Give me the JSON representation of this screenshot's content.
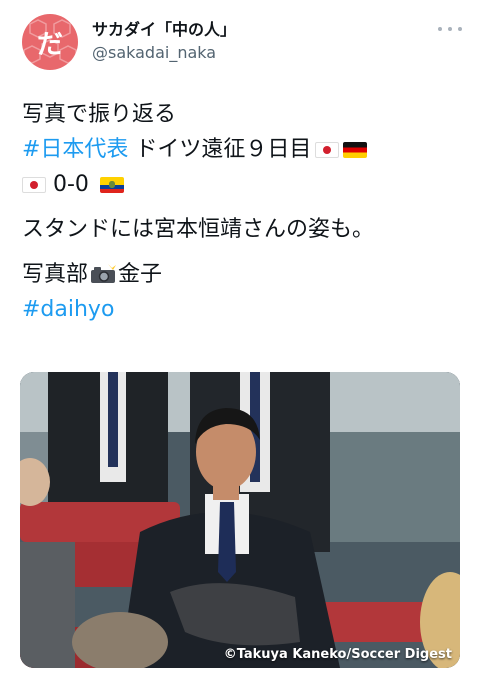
{
  "user": {
    "display_name": "サカダイ「中の人」",
    "handle": "@sakadai_naka",
    "avatar_glyph": "だ"
  },
  "tweet": {
    "line1": "写真で振り返る",
    "line2_hashtag": "#日本代表",
    "line2_text": " ドイツ遠征９日目",
    "line3_text": " 0-0 ",
    "line4": "スタンドには宮本恒靖さんの姿も。",
    "line5_a": "写真部",
    "line5_b": "金子",
    "line6_hashtag": "#daihyo"
  },
  "media": {
    "credit": "©Takuya Kaneko/Soccer Digest"
  },
  "icons": [
    "more-icon",
    "japan-flag-icon",
    "germany-flag-icon",
    "ecuador-flag-icon",
    "camera-flash-icon"
  ],
  "colors": {
    "hashtag": "#1d9bf0",
    "avatar": "#e8686c",
    "handle": "#536471"
  }
}
